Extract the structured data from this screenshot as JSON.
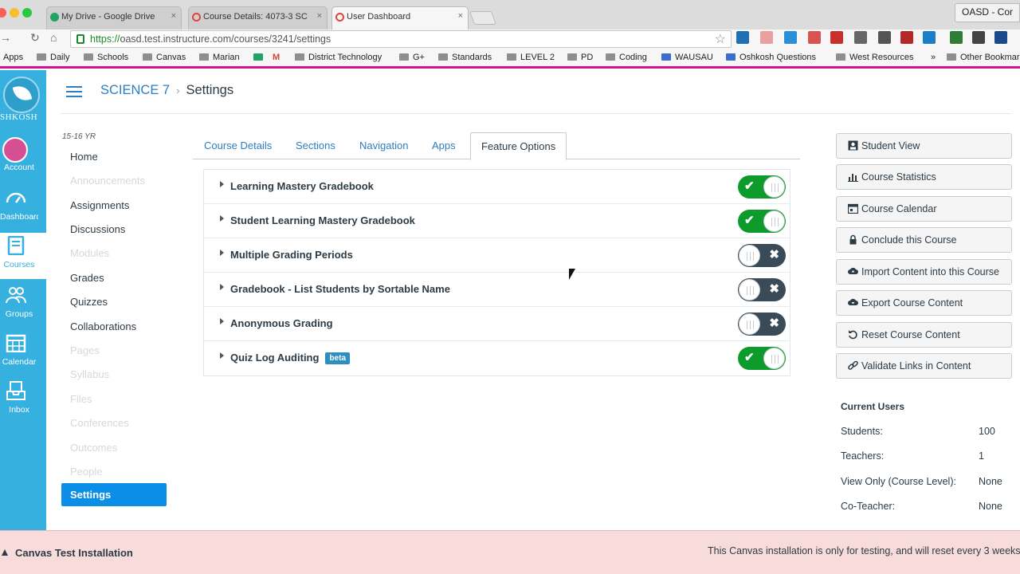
{
  "browser": {
    "tabs": [
      {
        "title": "My Drive - Google Drive",
        "close": "×",
        "icon_color": "#1fa463"
      },
      {
        "title": "Course Details: 4073-3 SC",
        "close": "×",
        "icon_color": "#e0453a"
      },
      {
        "title": "User Dashboard",
        "close": "×",
        "icon_color": "#e0453a"
      }
    ],
    "profile": "OASD - Cor",
    "url_secure": "https://",
    "url_rest": "oasd.test.instructure.com/courses/3241/settings",
    "star": "☆",
    "bookmarks": [
      "Apps",
      "Daily",
      "Schools",
      "Canvas",
      "Marian",
      "M",
      "District Technology",
      "G+",
      "Standards",
      "LEVEL 2",
      "PD",
      "Coding",
      "WAUSAU",
      "Oshkosh Questions",
      "West Resources",
      "»",
      "Other Bookmar"
    ]
  },
  "global_nav": {
    "logo_text": "SHKOSH",
    "items": [
      {
        "label": "Account",
        "icon": "avatar-icon"
      },
      {
        "label": "Dashboard",
        "icon": "dashboard-icon"
      },
      {
        "label": "Courses",
        "icon": "courses-icon"
      },
      {
        "label": "Groups",
        "icon": "groups-icon"
      },
      {
        "label": "Calendar",
        "icon": "calendar-icon"
      },
      {
        "label": "Inbox",
        "icon": "inbox-icon"
      }
    ],
    "active_color": "#36b0df"
  },
  "header": {
    "course": "SCIENCE 7",
    "separator": "›",
    "page": "Settings"
  },
  "course_nav": {
    "term": "15-16 YR",
    "items": [
      {
        "label": "Home",
        "disabled": false
      },
      {
        "label": "Announcements",
        "disabled": true
      },
      {
        "label": "Assignments",
        "disabled": false
      },
      {
        "label": "Discussions",
        "disabled": false
      },
      {
        "label": "Modules",
        "disabled": true
      },
      {
        "label": "Grades",
        "disabled": false
      },
      {
        "label": "Quizzes",
        "disabled": false
      },
      {
        "label": "Collaborations",
        "disabled": false
      },
      {
        "label": "Pages",
        "disabled": true
      },
      {
        "label": "Syllabus",
        "disabled": true
      },
      {
        "label": "Files",
        "disabled": true
      },
      {
        "label": "Conferences",
        "disabled": true
      },
      {
        "label": "Outcomes",
        "disabled": true
      },
      {
        "label": "People",
        "disabled": true
      }
    ],
    "active": "Settings"
  },
  "settings_tabs": [
    "Course Details",
    "Sections",
    "Navigation",
    "Apps",
    "Feature Options"
  ],
  "active_tab": "Feature Options",
  "features": [
    {
      "name": "Learning Mastery Gradebook",
      "enabled": true,
      "badge": ""
    },
    {
      "name": "Student Learning Mastery Gradebook",
      "enabled": true,
      "badge": ""
    },
    {
      "name": "Multiple Grading Periods",
      "enabled": false,
      "badge": ""
    },
    {
      "name": "Gradebook - List Students by Sortable Name",
      "enabled": false,
      "badge": ""
    },
    {
      "name": "Anonymous Grading",
      "enabled": false,
      "badge": ""
    },
    {
      "name": "Quiz Log Auditing",
      "enabled": true,
      "badge": "beta"
    }
  ],
  "toggle_symbols": {
    "on": "✔",
    "off": "✖"
  },
  "sidebar": {
    "buttons": [
      {
        "label": "Student View",
        "icon": "student-view-icon"
      },
      {
        "label": "Course Statistics",
        "icon": "statistics-icon"
      },
      {
        "label": "Course Calendar",
        "icon": "calendar-icon"
      },
      {
        "label": "Conclude this Course",
        "icon": "lock-icon"
      },
      {
        "label": "Import Content into this Course",
        "icon": "cloud-upload-icon"
      },
      {
        "label": "Export Course Content",
        "icon": "cloud-download-icon"
      },
      {
        "label": "Reset Course Content",
        "icon": "reset-icon"
      },
      {
        "label": "Validate Links in Content",
        "icon": "link-icon"
      }
    ],
    "current_users_title": "Current Users",
    "current_users": [
      {
        "label": "Students:",
        "value": "100"
      },
      {
        "label": "Teachers:",
        "value": "1"
      },
      {
        "label": "View Only (Course Level):",
        "value": "None"
      },
      {
        "label": "Co-Teacher:",
        "value": "None"
      }
    ]
  },
  "banner": {
    "title": "Canvas Test Installation",
    "message": "This Canvas installation is only for testing, and will reset every 3 weeks."
  }
}
